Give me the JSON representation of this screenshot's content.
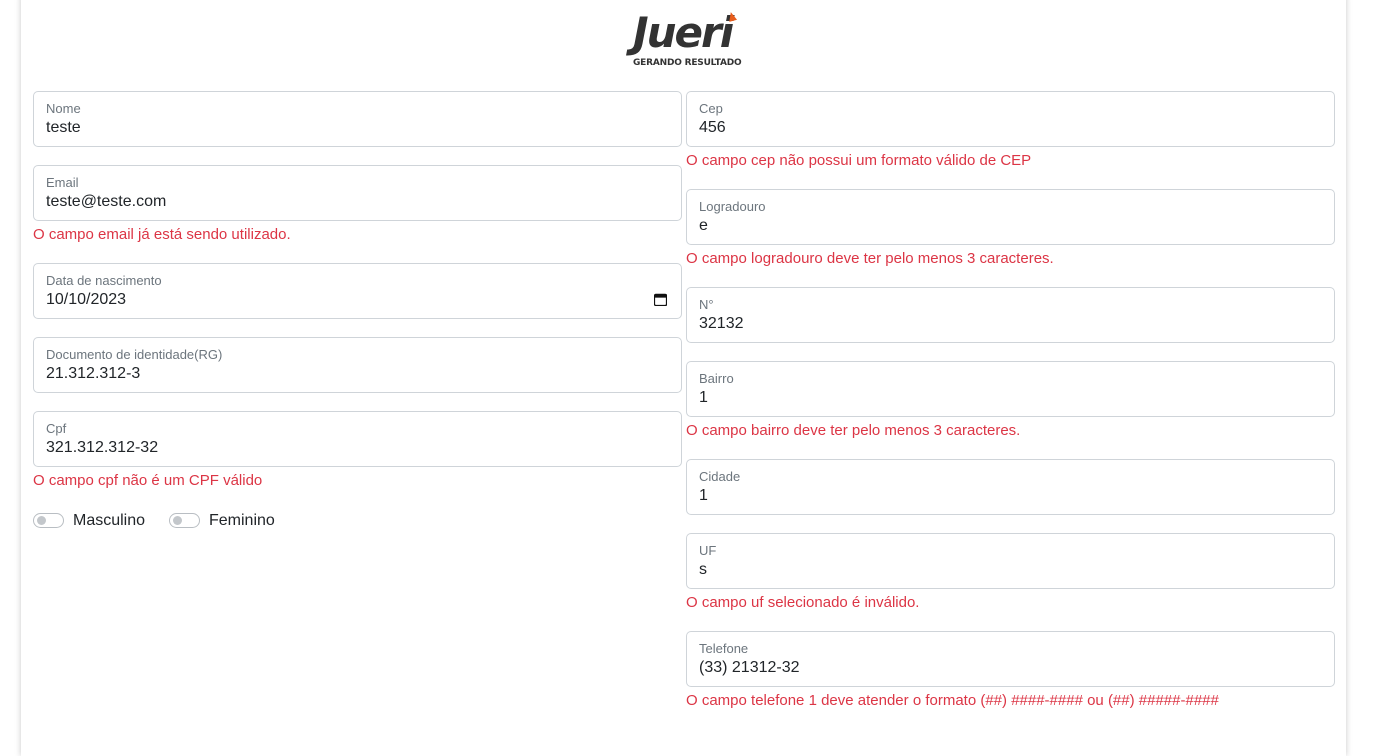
{
  "brand": {
    "logo_text": "Jueri",
    "tagline": "GERANDO RESULTADO",
    "flame_color": "#e85d1c"
  },
  "colors": {
    "error": "#dc3545",
    "border": "#cfd4d9",
    "label": "#6c757d"
  },
  "left": {
    "nome": {
      "label": "Nome",
      "value": "teste"
    },
    "email": {
      "label": "Email",
      "value": "teste@teste.com",
      "error": "O campo email já está sendo utilizado."
    },
    "nascimento": {
      "label": "Data de nascimento",
      "value": "10/10/2023",
      "icon": "calendar-icon"
    },
    "rg": {
      "label": "Documento de identidade(RG)",
      "value": "21.312.312-3"
    },
    "cpf": {
      "label": "Cpf",
      "value": "321.312.312-32",
      "error": "O campo cpf não é um CPF válido"
    },
    "gender": {
      "masculino": {
        "label": "Masculino",
        "checked": false
      },
      "feminino": {
        "label": "Feminino",
        "checked": false
      }
    }
  },
  "right": {
    "cep": {
      "label": "Cep",
      "value": "456",
      "error": "O campo cep não possui um formato válido de CEP"
    },
    "logradouro": {
      "label": "Logradouro",
      "value": "e",
      "error": "O campo logradouro deve ter pelo menos 3 caracteres."
    },
    "numero": {
      "label": "N°",
      "value": "32132"
    },
    "bairro": {
      "label": "Bairro",
      "value": "1",
      "error": "O campo bairro deve ter pelo menos 3 caracteres."
    },
    "cidade": {
      "label": "Cidade",
      "value": "1"
    },
    "uf": {
      "label": "UF",
      "value": "s",
      "error": "O campo uf selecionado é inválido."
    },
    "telefone": {
      "label": "Telefone",
      "value": "(33) 21312-32",
      "error": "O campo telefone 1 deve atender o formato (##) ####-#### ou (##) #####-####"
    }
  }
}
